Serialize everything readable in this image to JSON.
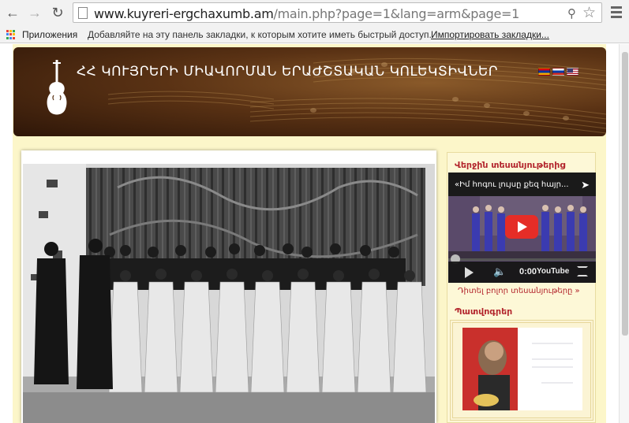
{
  "browser": {
    "back_icon": "arrow-left-icon",
    "forward_icon": "arrow-right-icon",
    "reload_icon": "reload-icon",
    "url_host": "www.kuyreri-ergchaxumb.am",
    "url_path": "/main.php?page=1&lang=arm&page=1",
    "zoom_icon": "magnifier-icon",
    "star_icon": "star-icon",
    "menu_icon": "hamburger-menu-icon"
  },
  "bookmarks": {
    "apps_label": "Приложения",
    "hint": "Добавляйте на эту панель закладки, к которым хотите иметь быстрый доступ.",
    "import_label": "Импортировать закладки..."
  },
  "site": {
    "title": "ՀՀ ԿՈՒՅՐԵՐԻ ՄԻԱՎՈՐՄԱՆ ԵՐԱԺՇՏԱԿԱՆ ԿՈԼԵԿՏԻՎՆԵՐ",
    "logo_icon": "violin-icon",
    "languages": [
      "hy",
      "ru",
      "en"
    ]
  },
  "sidebar": {
    "videos_title": "Վերջին տեսանյութերից",
    "video_title": "«Իմ հոգու լույսը քեզ հայր...",
    "video_time": "0:00",
    "video_brand": "YouTube",
    "see_all_videos": "Դիտել բոլոր տեսանյութերը »",
    "documents_title": "Պատվոգրեր"
  },
  "colors": {
    "accent_red": "#b2232b",
    "page_background": "#fcf6c9",
    "banner_brown": "#5a3214"
  }
}
